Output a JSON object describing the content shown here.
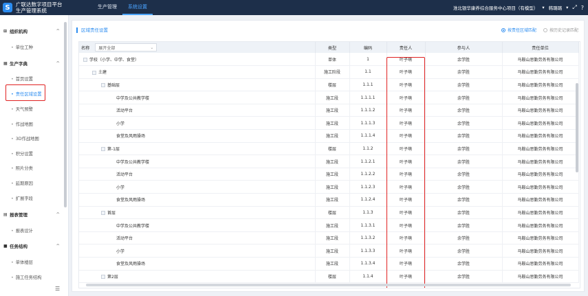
{
  "header": {
    "logo_letter": "S",
    "brand_line1": "广联达数字项目平台",
    "brand_line2": "生产管理系统",
    "nav": [
      {
        "label": "生产管理"
      },
      {
        "label": "系统设置"
      }
    ],
    "project": "淮北银华康养综合服务中心项目（有模型）",
    "project_chevron": "▾",
    "user": "韩璐璐",
    "user_chevron": "▾",
    "icon_expand": "⤢",
    "icon_help": "?"
  },
  "sidebar": {
    "groups": [
      {
        "label": "组织机构",
        "icon": "⊞",
        "chevron": "^"
      },
      {
        "label": "生产字典",
        "icon": "▦",
        "chevron": "^"
      },
      {
        "label": "报表管理",
        "icon": "▤",
        "chevron": "^"
      },
      {
        "label": "任务结构",
        "icon": "■",
        "chevron": "^"
      }
    ],
    "items": [
      {
        "label": "单位工种"
      },
      {
        "label": "首页设置"
      },
      {
        "label": "责任区域设置"
      },
      {
        "label": "天气预警"
      },
      {
        "label": "作战地图"
      },
      {
        "label": "3D作战地图"
      },
      {
        "label": "积分设置"
      },
      {
        "label": "照片分类"
      },
      {
        "label": "延期原因"
      },
      {
        "label": "扩展字段"
      },
      {
        "label": "报表设计"
      },
      {
        "label": "单体楼层"
      },
      {
        "label": "施工任务结构"
      }
    ],
    "collapse_icon": "☰"
  },
  "main": {
    "title": "区域责任设置",
    "radio_on": "按责任区域匹配",
    "radio_off": "按历史记录匹配",
    "expand_select": "展开全部",
    "columns": [
      "名称",
      "类型",
      "编码",
      "责任人",
      "参与人",
      "责任单位"
    ],
    "rows": [
      {
        "name": "学校（小学、中学、食堂）",
        "type": "单体",
        "code": "1",
        "owner": "叶子萌",
        "participant": "余学胜",
        "unit": "马鞍山思勤劳务有限公司"
      },
      {
        "name": "土建",
        "type": "施工阶段",
        "code": "1.1",
        "owner": "叶子萌",
        "participant": "余学胜",
        "unit": "马鞍山思勤劳务有限公司"
      },
      {
        "name": "基础层",
        "type": "楼层",
        "code": "1.1.1",
        "owner": "叶子萌",
        "participant": "余学胜",
        "unit": "马鞍山思勤劳务有限公司"
      },
      {
        "name": "中学及公共教学楼",
        "type": "施工段",
        "code": "1.1.1.1",
        "owner": "叶子萌",
        "participant": "余学胜",
        "unit": "马鞍山思勤劳务有限公司"
      },
      {
        "name": "活动平台",
        "type": "施工段",
        "code": "1.1.1.2",
        "owner": "叶子萌",
        "participant": "余学胜",
        "unit": "马鞍山思勤劳务有限公司"
      },
      {
        "name": "小学",
        "type": "施工段",
        "code": "1.1.1.3",
        "owner": "叶子萌",
        "participant": "余学胜",
        "unit": "马鞍山思勤劳务有限公司"
      },
      {
        "name": "食堂及风雨操场",
        "type": "施工段",
        "code": "1.1.1.4",
        "owner": "叶子萌",
        "participant": "余学胜",
        "unit": "马鞍山思勤劳务有限公司"
      },
      {
        "name": "第-1层",
        "type": "楼层",
        "code": "1.1.2",
        "owner": "叶子萌",
        "participant": "余学胜",
        "unit": "马鞍山思勤劳务有限公司"
      },
      {
        "name": "中学及公共教学楼",
        "type": "施工段",
        "code": "1.1.2.1",
        "owner": "叶子萌",
        "participant": "余学胜",
        "unit": "马鞍山思勤劳务有限公司"
      },
      {
        "name": "活动平台",
        "type": "施工段",
        "code": "1.1.2.2",
        "owner": "叶子萌",
        "participant": "余学胜",
        "unit": "马鞍山思勤劳务有限公司"
      },
      {
        "name": "小学",
        "type": "施工段",
        "code": "1.1.2.3",
        "owner": "叶子萌",
        "participant": "余学胜",
        "unit": "马鞍山思勤劳务有限公司"
      },
      {
        "name": "食堂及风雨操场",
        "type": "施工段",
        "code": "1.1.2.4",
        "owner": "叶子萌",
        "participant": "余学胜",
        "unit": "马鞍山思勤劳务有限公司"
      },
      {
        "name": "首层",
        "type": "楼层",
        "code": "1.1.3",
        "owner": "叶子萌",
        "participant": "余学胜",
        "unit": "马鞍山思勤劳务有限公司"
      },
      {
        "name": "中学及公共教学楼",
        "type": "施工段",
        "code": "1.1.3.1",
        "owner": "叶子萌",
        "participant": "余学胜",
        "unit": "马鞍山思勤劳务有限公司"
      },
      {
        "name": "活动平台",
        "type": "施工段",
        "code": "1.1.3.2",
        "owner": "叶子萌",
        "participant": "余学胜",
        "unit": "马鞍山思勤劳务有限公司"
      },
      {
        "name": "小学",
        "type": "施工段",
        "code": "1.1.3.3",
        "owner": "叶子萌",
        "participant": "余学胜",
        "unit": "马鞍山思勤劳务有限公司"
      },
      {
        "name": "食堂及风雨操场",
        "type": "施工段",
        "code": "1.1.3.4",
        "owner": "叶子萌",
        "participant": "余学胜",
        "unit": "马鞍山思勤劳务有限公司"
      },
      {
        "name": "第2层",
        "type": "楼层",
        "code": "1.1.4",
        "owner": "叶子萌",
        "participant": "余学胜",
        "unit": "马鞍山思勤劳务有限公司"
      }
    ]
  }
}
